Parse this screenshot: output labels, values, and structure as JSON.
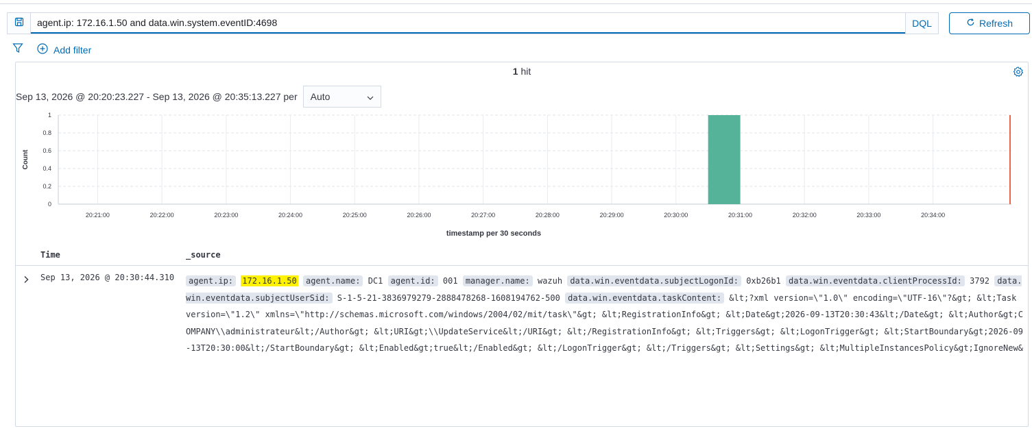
{
  "query": {
    "value": "agent.ip: 172.16.1.50 and data.win.system.eventID:4698",
    "language_label": "DQL",
    "save_icon": "save-query-icon"
  },
  "refresh": {
    "label": "Refresh",
    "icon": "refresh-icon"
  },
  "filters": {
    "add_label": "Add filter",
    "filter_icon": "funnel-icon",
    "add_icon": "plus-circle-icon"
  },
  "panel": {
    "hits_count": "1",
    "hits_label": "hit",
    "time_range": "Sep 13, 2026 @ 20:20:23.227 - Sep 13, 2026 @ 20:35:13.227 per",
    "interval": "Auto"
  },
  "chart_data": {
    "type": "bar",
    "ylabel": "Count",
    "xlabel": "timestamp per 30 seconds",
    "ylim": [
      0,
      1
    ],
    "y_ticks": [
      "0",
      "0.2",
      "0.4",
      "0.6",
      "0.8",
      "1"
    ],
    "x_ticks": [
      "20:21:00",
      "20:22:00",
      "20:23:00",
      "20:24:00",
      "20:25:00",
      "20:26:00",
      "20:27:00",
      "20:28:00",
      "20:29:00",
      "20:30:00",
      "20:31:00",
      "20:32:00",
      "20:33:00",
      "20:34:00"
    ],
    "bars": [
      {
        "x": "20:30:30",
        "value": 1
      }
    ],
    "bar_color": "#54b399",
    "now_marker_color": "#e7664c",
    "grid": true
  },
  "table": {
    "headers": {
      "time": "Time",
      "source": "_source"
    },
    "rows": [
      {
        "time": "Sep 13, 2026 @ 20:30:44.310",
        "fields": [
          {
            "key": "agent.ip:",
            "value": "172.16.1.50",
            "highlight": true
          },
          {
            "key": "agent.name:",
            "value": "DC1"
          },
          {
            "key": "agent.id:",
            "value": "001"
          },
          {
            "key": "manager.name:",
            "value": "wazuh"
          },
          {
            "key": "data.win.eventdata.subjectLogonId:",
            "value": "0xb26b1"
          },
          {
            "key": "data.win.eventdata.clientProcessId:",
            "value": "3792"
          },
          {
            "key": "data.win.eventdata.subjectUserSid:",
            "value": "S-1-5-21-3836979279-2888478268-1608194762-500"
          },
          {
            "key": "data.win.eventdata.taskContent:",
            "value": "&lt;?xml version=\\\"1.0\\\" encoding=\\\"UTF-16\\\"?&gt; &lt;Task version=\\\"1.2\\\" xmlns=\\\"http://schemas.microsoft.com/windows/2004/02/mit/task\\\"&gt; &lt;RegistrationInfo&gt; &lt;Date&gt;2026-09-13T20:30:43&lt;/Date&gt; &lt;Author&gt;COMPANY\\\\administrateur&lt;/Author&gt; &lt;URI&gt;\\\\UpdateService&lt;/URI&gt; &lt;/RegistrationInfo&gt; &lt;Triggers&gt; &lt;LogonTrigger&gt; &lt;StartBoundary&gt;2026-09-13T20:30:00&lt;/StartBoundary&gt; &lt;Enabled&gt;true&lt;/Enabled&gt; &lt;/LogonTrigger&gt; &lt;/Triggers&gt; &lt;Settings&gt; &lt;MultipleInstancesPolicy&gt;IgnoreNew&lt;/MultipleInstancesPolicy&gt;"
          }
        ]
      }
    ]
  }
}
